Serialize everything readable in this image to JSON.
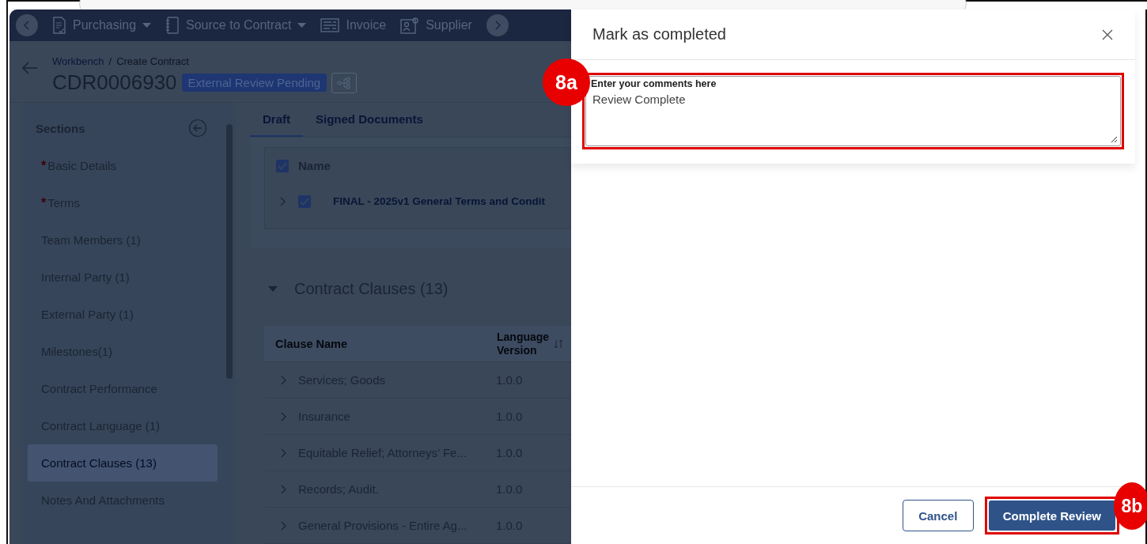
{
  "nav": {
    "items": [
      {
        "label": "Purchasing",
        "kind": "document",
        "dropdown": true
      },
      {
        "label": "Source to Contract",
        "kind": "notebook",
        "dropdown": true
      },
      {
        "label": "Invoice",
        "kind": "receipt",
        "dropdown": false
      },
      {
        "label": "Supplier",
        "kind": "person",
        "dropdown": false
      }
    ]
  },
  "breadcrumb": [
    "Workbench",
    "/",
    "Create Contract"
  ],
  "contract": {
    "id": "CDR0006930",
    "status": "External Review Pending"
  },
  "sections": {
    "title": "Sections",
    "required_mark": "*",
    "items": [
      {
        "label": "Basic Details",
        "required": true,
        "selected": false
      },
      {
        "label": "Terms",
        "required": true,
        "selected": false
      },
      {
        "label": "Team Members (1)",
        "required": false,
        "selected": false
      },
      {
        "label": "Internal Party (1)",
        "required": false,
        "selected": false
      },
      {
        "label": "External Party (1)",
        "required": false,
        "selected": false
      },
      {
        "label": "Milestones(1)",
        "required": false,
        "selected": false
      },
      {
        "label": "Contract Performance",
        "required": false,
        "selected": false
      },
      {
        "label": "Contract Language (1)",
        "required": false,
        "selected": false
      },
      {
        "label": "Contract Clauses (13)",
        "required": false,
        "selected": true
      },
      {
        "label": "Notes And Attachments",
        "required": false,
        "selected": false
      }
    ]
  },
  "tabs": [
    {
      "label": "Draft",
      "selected": true
    },
    {
      "label": "Signed Documents",
      "selected": false
    }
  ],
  "documents": {
    "header": "Name",
    "header_checked": true,
    "rows": [
      {
        "name": "FINAL - 2025v1 General Terms and Condit",
        "checked": true
      }
    ]
  },
  "clauses": {
    "title": "Contract Clauses (13)",
    "expanded": true,
    "columns": [
      "Clause Name",
      "Language Version"
    ],
    "rows": [
      {
        "name": "Services; Goods",
        "version": "1.0.0"
      },
      {
        "name": "Insurance",
        "version": "1.0.0"
      },
      {
        "name": "Equitable Relief; Attorneys’ Fe...",
        "version": "1.0.0"
      },
      {
        "name": "Records; Audit.",
        "version": "1.0.0"
      },
      {
        "name": "General Provisions - Entire Ag...",
        "version": "1.0.0"
      }
    ]
  },
  "dialog": {
    "title": "Mark as completed",
    "comment_label": "Enter your comments here",
    "comment": "Review Complete",
    "cancel": "Cancel",
    "submit": "Complete Review"
  },
  "annotations": [
    {
      "label": "8a"
    },
    {
      "label": "8b"
    }
  ]
}
